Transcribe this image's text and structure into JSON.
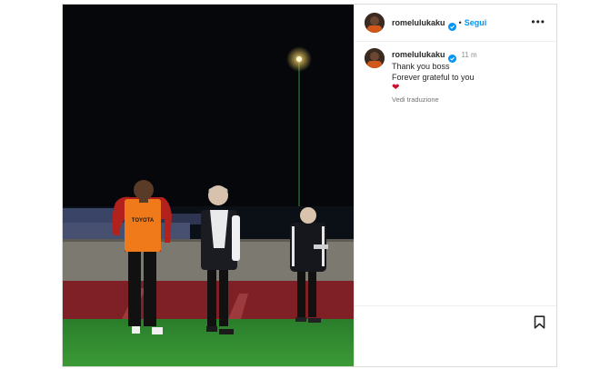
{
  "post": {
    "username": "romelulukaku",
    "follow_label": "Segui",
    "separator": "•",
    "more_label": "•••"
  },
  "caption": {
    "username": "romelulukaku",
    "time": "11 m",
    "lines": [
      "Thank you boss",
      "Forever grateful to you"
    ],
    "emoji": "❤",
    "translate_label": "Vedi traduzione"
  },
  "photo": {
    "bib_text": "TOYOTA"
  },
  "icons": {
    "verified": "verified-badge-icon",
    "more": "more-options-icon",
    "bookmark": "bookmark-icon"
  },
  "colors": {
    "link": "#0095f6",
    "verified": "#0095f6",
    "heart": "#c8102e",
    "pitch": "#2f8a2e",
    "bib": "#f07a1a"
  }
}
